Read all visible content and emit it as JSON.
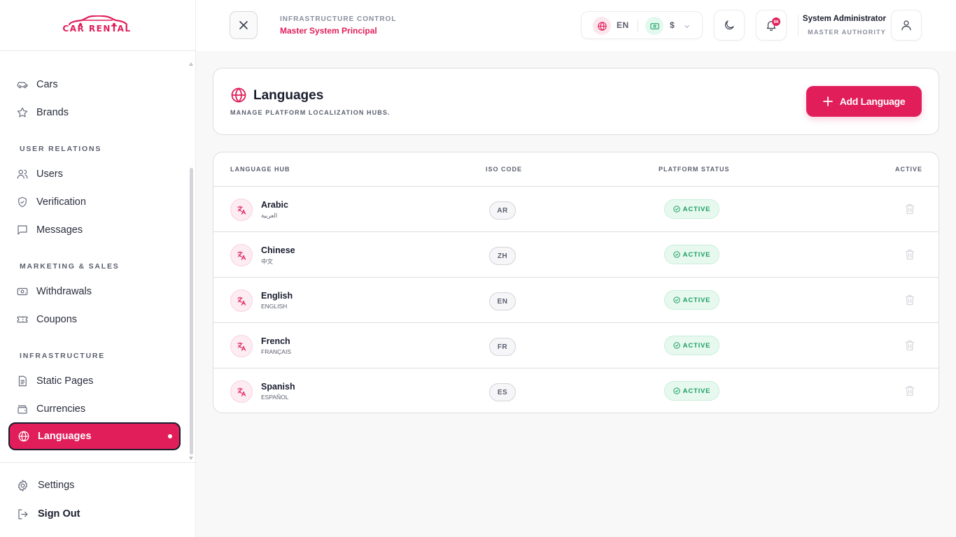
{
  "brand": {
    "logo_text": "CAR RENTAL",
    "accent": "#e11d5a"
  },
  "sidebar": {
    "items_top": [
      {
        "label": "Cars",
        "icon": "car-icon"
      },
      {
        "label": "Brands",
        "icon": "star-icon"
      }
    ],
    "sections": [
      {
        "title": "USER RELATIONS",
        "items": [
          {
            "label": "Users",
            "icon": "users-icon"
          },
          {
            "label": "Verification",
            "icon": "shield-check-icon"
          },
          {
            "label": "Messages",
            "icon": "message-icon"
          }
        ]
      },
      {
        "title": "MARKETING & SALES",
        "items": [
          {
            "label": "Withdrawals",
            "icon": "banknote-icon"
          },
          {
            "label": "Coupons",
            "icon": "ticket-icon"
          }
        ]
      },
      {
        "title": "INFRASTRUCTURE",
        "items": [
          {
            "label": "Static Pages",
            "icon": "document-icon"
          },
          {
            "label": "Currencies",
            "icon": "wallet-icon"
          },
          {
            "label": "Languages",
            "icon": "globe-icon",
            "active": true
          }
        ]
      }
    ],
    "footer": {
      "settings": "Settings",
      "signout": "Sign Out"
    }
  },
  "header": {
    "sup": "INFRASTRUCTURE CONTROL",
    "title": "Master System Principal",
    "language": "EN",
    "currency": "$",
    "notification_count": "86",
    "user_name": "System Administrator",
    "user_role": "MASTER AUTHORITY"
  },
  "page": {
    "title": "Languages",
    "subtitle": "MANAGE PLATFORM LOCALIZATION HUBS.",
    "add_button": "Add Language"
  },
  "table": {
    "columns": [
      "LANGUAGE HUB",
      "ISO CODE",
      "PLATFORM STATUS",
      "ACTIVE"
    ],
    "rows": [
      {
        "name": "Arabic",
        "native": "العربية",
        "iso": "AR",
        "status": "ACTIVE"
      },
      {
        "name": "Chinese",
        "native": "中文",
        "iso": "ZH",
        "status": "ACTIVE"
      },
      {
        "name": "English",
        "native": "ENGLISH",
        "iso": "EN",
        "status": "ACTIVE"
      },
      {
        "name": "French",
        "native": "FRANÇAIS",
        "iso": "FR",
        "status": "ACTIVE"
      },
      {
        "name": "Spanish",
        "native": "ESPAÑOL",
        "iso": "ES",
        "status": "ACTIVE"
      }
    ]
  }
}
